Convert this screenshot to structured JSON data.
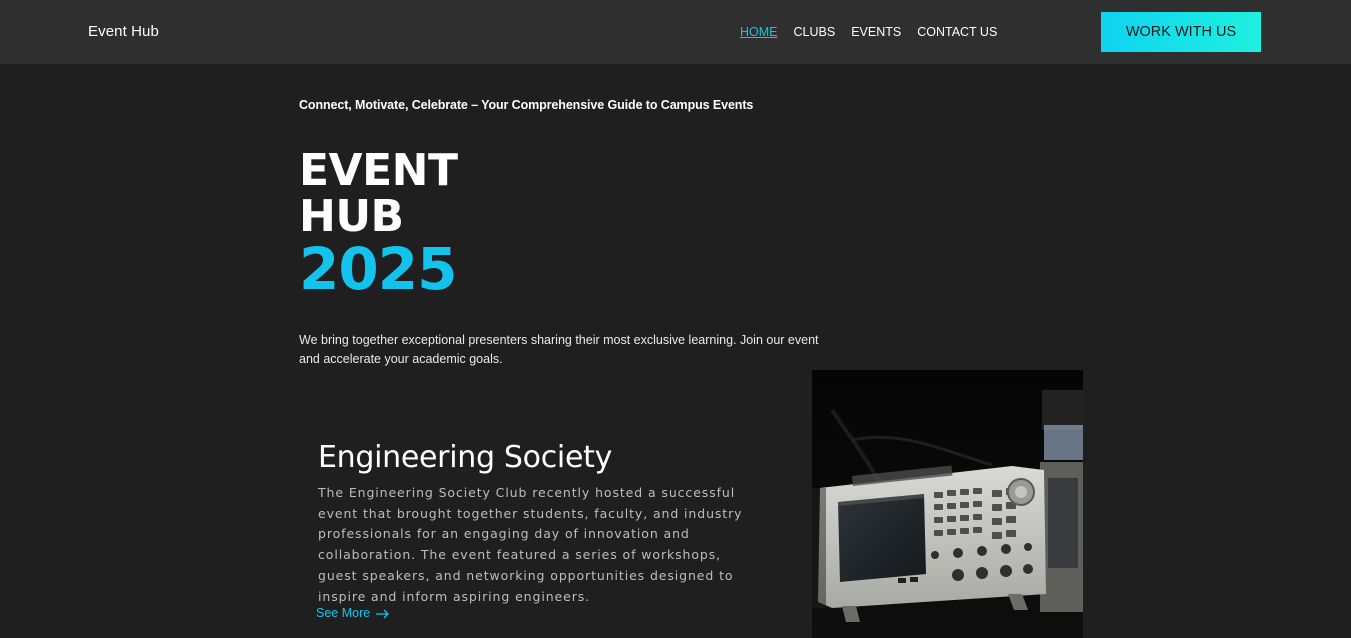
{
  "nav": {
    "brand": "Event Hub",
    "links": [
      "HOME",
      "CLUBS",
      "EVENTS",
      "CONTACT US"
    ],
    "cta": "WORK WITH US"
  },
  "hero": {
    "tagline": "Connect, Motivate, Celebrate – Your Comprehensive Guide to Campus Events",
    "title_line1": "EVENT",
    "title_line2": "HUB",
    "year": "2025",
    "description": "We bring together exceptional presenters sharing their most exclusive learning. Join our event and accelerate your academic goals."
  },
  "club": {
    "title": "Engineering Society",
    "description": "The Engineering Society Club recently hosted a successful event that brought together students, faculty, and industry professionals for an engaging day of innovation and collaboration. The event featured a series of workshops, guest speakers, and networking opportunities designed to inspire and inform aspiring engineers.",
    "link": "See More",
    "image_subject": "oscilloscope-equipment-photo"
  },
  "colors": {
    "accent": "#13c5ee",
    "nav_bg": "#2f2f2f",
    "page_bg": "#1f1f1f",
    "cta_gradient_start": "#10d3f0",
    "cta_gradient_end": "#1ef0e0"
  }
}
